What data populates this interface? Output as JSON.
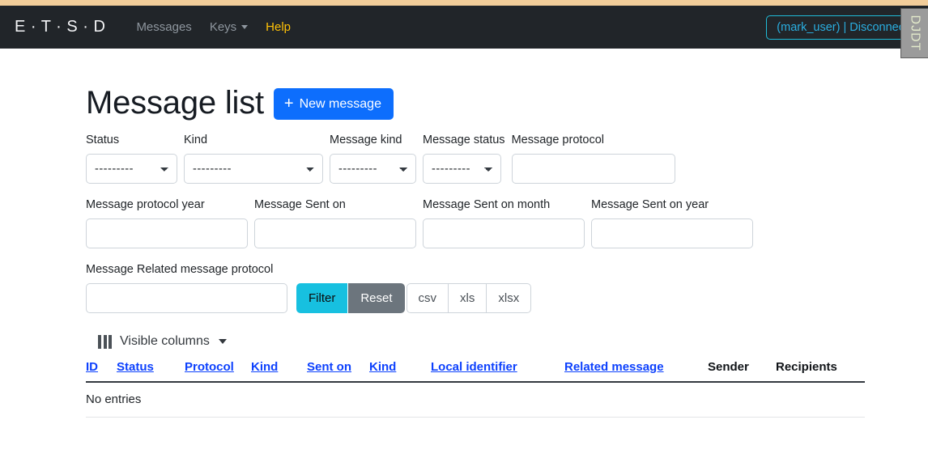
{
  "navbar": {
    "brand": "E · T · S · D",
    "links": [
      {
        "label": "Messages",
        "style": "muted"
      },
      {
        "label": "Keys",
        "style": "muted-dropdown"
      },
      {
        "label": "Help",
        "style": "warning"
      }
    ],
    "user_badge": "(mark_user) | Disconnect"
  },
  "debug_toolbar": {
    "label": "DJDT"
  },
  "header": {
    "title": "Message list",
    "new_button_label": "New message",
    "new_button_icon": "plus-icon",
    "new_button_color": "#0d6efd"
  },
  "filters": {
    "placeholder_dashes": "---------",
    "row1": [
      {
        "label": "Status",
        "type": "select",
        "value": "---------",
        "width": "w-status"
      },
      {
        "label": "Kind",
        "type": "select",
        "value": "---------",
        "width": "w-kind"
      },
      {
        "label": "Message kind",
        "type": "select",
        "value": "---------",
        "width": "w-mkind"
      },
      {
        "label": "Message status",
        "type": "select",
        "value": "---------",
        "width": "w-mstat"
      },
      {
        "label": "Message protocol",
        "type": "text",
        "value": "",
        "width": "w-mprot"
      }
    ],
    "row2": [
      {
        "label": "Message protocol year",
        "type": "text",
        "value": "",
        "width": "w-mprotyear"
      },
      {
        "label": "Message Sent on",
        "type": "text",
        "value": "",
        "width": "w-msenton"
      },
      {
        "label": "Message Sent on month",
        "type": "text",
        "value": "",
        "width": "w-msmonth"
      },
      {
        "label": "Message Sent on year",
        "type": "text",
        "value": "",
        "width": "w-msyear"
      }
    ],
    "row3": {
      "label": "Message Related message protocol",
      "value": ""
    },
    "buttons": {
      "filter": "Filter",
      "reset": "Reset",
      "csv": "csv",
      "xls": "xls",
      "xlsx": "xlsx"
    },
    "colors": {
      "filter_bg": "#17c0e0",
      "reset_bg": "#6c757d",
      "export_border": "#ced4da"
    }
  },
  "visible_columns": {
    "label": "Visible columns",
    "icon": "columns-icon"
  },
  "table": {
    "columns": [
      {
        "label": "ID",
        "sortable": true,
        "class": "c-id"
      },
      {
        "label": "Status",
        "sortable": true,
        "class": "c-stat"
      },
      {
        "label": "Protocol",
        "sortable": true,
        "class": "c-prot"
      },
      {
        "label": "Kind",
        "sortable": true,
        "class": "c-kind1"
      },
      {
        "label": "Sent on",
        "sortable": true,
        "class": "c-sent"
      },
      {
        "label": "Kind",
        "sortable": true,
        "class": "c-kind2"
      },
      {
        "label": "Local identifier",
        "sortable": true,
        "class": "c-local"
      },
      {
        "label": "Related message",
        "sortable": true,
        "class": "c-rel"
      },
      {
        "label": "Sender",
        "sortable": false,
        "class": "c-send"
      },
      {
        "label": "Recipients",
        "sortable": false,
        "class": "c-recip"
      }
    ],
    "rows": [],
    "empty_message": "No entries"
  }
}
